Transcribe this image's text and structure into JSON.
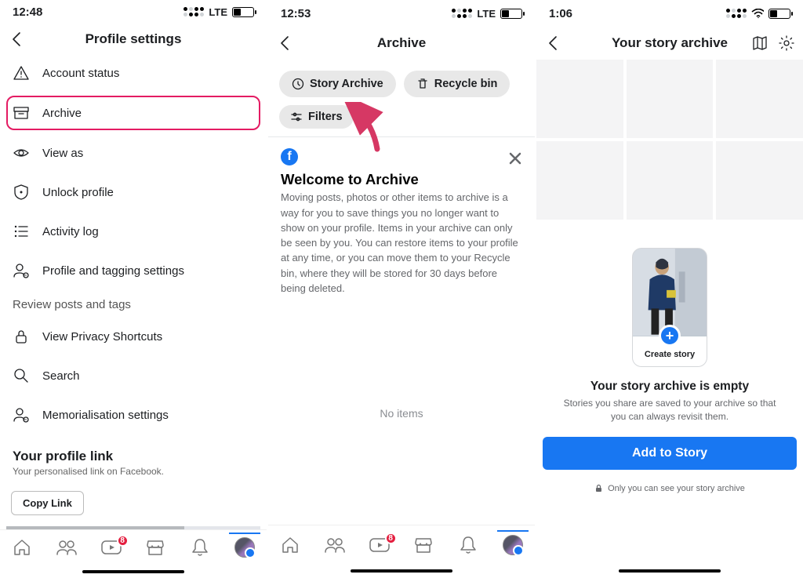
{
  "screens": [
    {
      "status": {
        "time": "12:48",
        "net": "LTE"
      },
      "title": "Profile settings",
      "settings_items": [
        {
          "icon": "alert-triangle-icon",
          "label": "Account status"
        },
        {
          "icon": "archive-box-icon",
          "label": "Archive",
          "highlighted": true
        },
        {
          "icon": "eye-icon",
          "label": "View as"
        },
        {
          "icon": "shield-lock-icon",
          "label": "Unlock profile"
        },
        {
          "icon": "list-icon",
          "label": "Activity log"
        },
        {
          "icon": "user-gear-icon",
          "label": "Profile and tagging settings"
        }
      ],
      "section_label": "Review posts and tags",
      "more_items": [
        {
          "icon": "lock-icon",
          "label": "View Privacy Shortcuts"
        },
        {
          "icon": "search-icon",
          "label": "Search"
        },
        {
          "icon": "user-gear-icon",
          "label": "Memorialisation settings"
        }
      ],
      "profile_link": {
        "title": "Your profile link",
        "sub": "Your personalised link on Facebook.",
        "button": "Copy Link"
      },
      "tab_badge": "8"
    },
    {
      "status": {
        "time": "12:53",
        "net": "LTE"
      },
      "title": "Archive",
      "chips": [
        {
          "icon": "clock-history-icon",
          "label": "Story Archive"
        },
        {
          "icon": "trash-icon",
          "label": "Recycle bin"
        }
      ],
      "filters_label": "Filters",
      "welcome": {
        "title": "Welcome to Archive",
        "body": "Moving posts, photos or other items to archive is a way for you to save things you no longer want to show on your profile. Items in your archive can only be seen by you. You can restore items to your profile at any time, or you can move them to your Recycle bin, where they will be stored for 30 days before being deleted."
      },
      "no_items": "No items",
      "tab_badge": "8"
    },
    {
      "status": {
        "time": "1:06"
      },
      "title": "Your story archive",
      "create_story": "Create story",
      "empty_title": "Your story archive is empty",
      "empty_sub": "Stories you share are saved to your archive so that you can always revisit them.",
      "add_button": "Add to Story",
      "only_you": "Only you can see your story archive"
    }
  ]
}
